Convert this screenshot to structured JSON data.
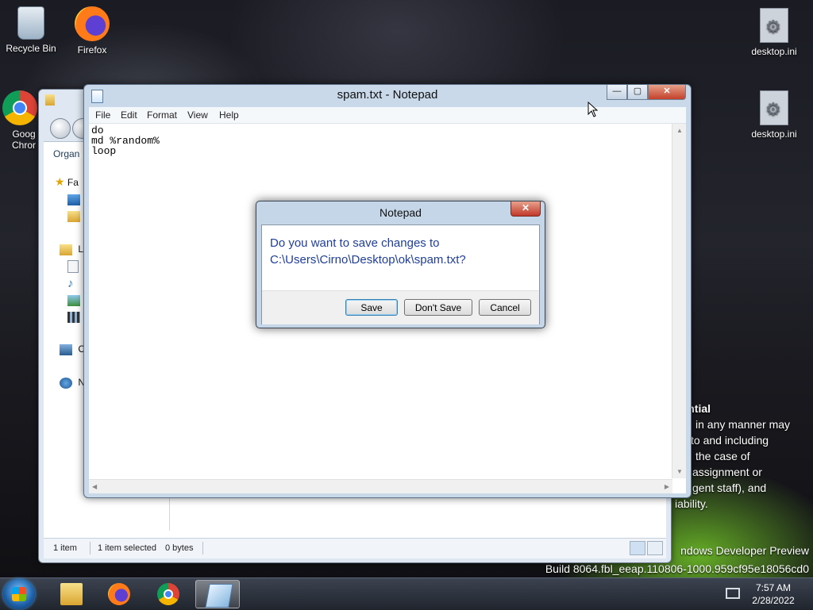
{
  "desktop": {
    "icons": [
      {
        "label": "Recycle Bin",
        "icon": "recycle-bin-icon"
      },
      {
        "label": "Firefox",
        "icon": "firefox-icon"
      },
      {
        "label": "Goog Chror",
        "icon": "chrome-icon"
      },
      {
        "label": "desktop.ini",
        "icon": "settings-file-icon"
      },
      {
        "label": "desktop.ini",
        "icon": "settings-file-icon"
      }
    ],
    "legal_lines": [
      "idential",
      "in any manner may",
      "to and including",
      "the case of",
      "assignment or",
      "gent staff), and",
      "iability."
    ],
    "build_line1": "ndows Developer Preview",
    "build_line2": "Build 8064.fbl_eeap.110806-1000.959cf95e18056cd0"
  },
  "explorer": {
    "organize_label": "Organ",
    "nav_items": [
      "Fa",
      "Li",
      "C",
      "N"
    ],
    "status": {
      "count": "1 item",
      "selected": "1 item selected",
      "size": "0 bytes"
    }
  },
  "notepad": {
    "title": "spam.txt - Notepad",
    "menu": [
      "File",
      "Edit",
      "Format",
      "View",
      "Help"
    ],
    "content": "do\nmd %random%\nloop",
    "controls": {
      "minimize": "—",
      "maximize": "▢",
      "close": "✕"
    }
  },
  "dialog": {
    "title": "Notepad",
    "message_line1": "Do you want to save changes to",
    "message_line2": "C:\\Users\\Cirno\\Desktop\\ok\\spam.txt?",
    "buttons": {
      "save": "Save",
      "dont_save": "Don't Save",
      "cancel": "Cancel"
    },
    "close": "✕"
  },
  "taskbar": {
    "items": [
      "file-explorer",
      "firefox",
      "chrome",
      "notepad"
    ],
    "active_item": "notepad",
    "clock_time": "7:57 AM",
    "clock_date": "2/28/2022"
  }
}
